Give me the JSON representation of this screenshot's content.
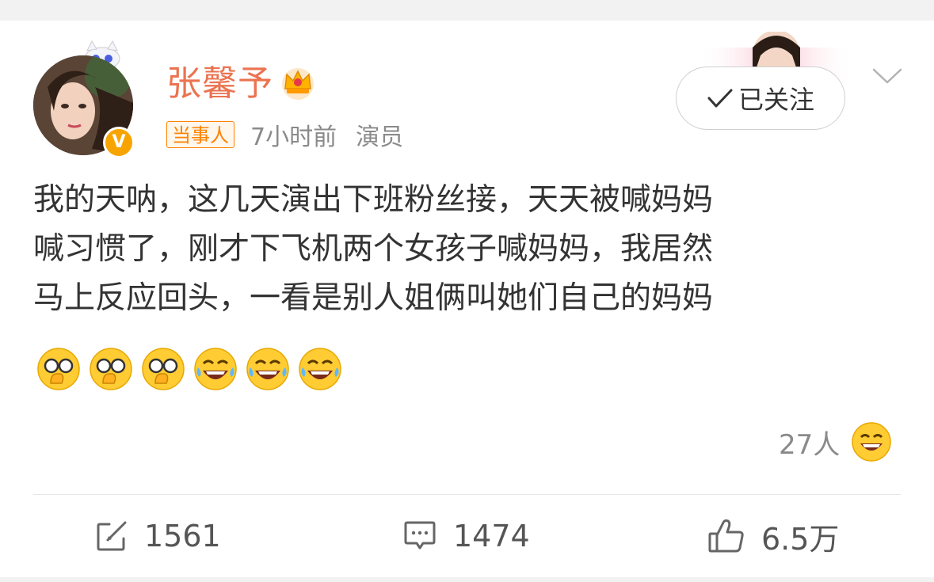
{
  "post": {
    "author": {
      "name": "张馨予",
      "badge": "当事人",
      "time": "7小时前",
      "source": "演员"
    },
    "follow_label": "已关注",
    "content_lines": [
      "我的天呐，这几天演出下班粉丝接，天天被喊妈妈",
      "喊习惯了，刚才下飞机两个女孩子喊妈妈，我居然",
      "马上反应回头，一看是别人姐俩叫她们自己的妈妈"
    ],
    "emojis": [
      "facepalm-glasses-emoji",
      "facepalm-glasses-emoji",
      "facepalm-glasses-emoji",
      "laugh-tears-emoji",
      "laugh-tears-emoji",
      "laugh-tears-emoji"
    ],
    "likers_count": "27人",
    "actions": {
      "repost": "1561",
      "comment": "1474",
      "like": "6.5万"
    }
  },
  "colors": {
    "name": "#eb7350",
    "tag": "#ff8200",
    "meta": "#8a8a8a"
  },
  "icons": [
    "crown-icon",
    "verified-icon",
    "check-icon",
    "chevron-down-icon",
    "repost-icon",
    "comment-icon",
    "like-icon"
  ]
}
